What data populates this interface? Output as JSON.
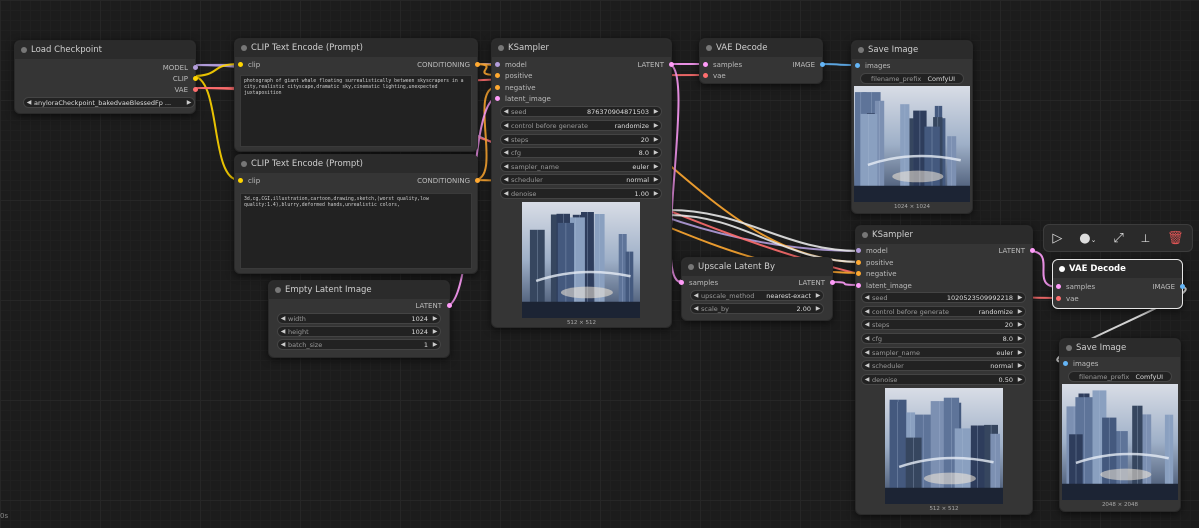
{
  "colors": {
    "model": "#b39ddb",
    "clip": "#ffd500",
    "vae": "#ff6e6e",
    "conditioning": "#ffa931",
    "latent": "#ff9cf9",
    "image": "#64b5f6"
  },
  "load_checkpoint": {
    "title": "Load Checkpoint",
    "out_model": "MODEL",
    "out_clip": "CLIP",
    "out_vae": "VAE",
    "ckpt": "anyloraCheckpoint_bakedvaeBlessedFp ..."
  },
  "clip_pos": {
    "title": "CLIP Text Encode (Prompt)",
    "in_clip": "clip",
    "out": "CONDITIONING",
    "text": "photograph of giant whale floating surrealistically between skyscrapers in a city,realistic cityscape,dramatic sky,cinematic lighting,unexpected juxtaposition"
  },
  "clip_neg": {
    "title": "CLIP Text Encode (Prompt)",
    "in_clip": "clip",
    "out": "CONDITIONING",
    "text": "3d,cg,CGI,illustration,cartoon,drawing,sketch,(worst quality,low quality:1.4),blurry,deformed hands,unrealistic colors,"
  },
  "empty_latent": {
    "title": "Empty Latent Image",
    "out": "LATENT",
    "width_label": "width",
    "width": "1024",
    "height_label": "height",
    "height": "1024",
    "batch_label": "batch_size",
    "batch": "1"
  },
  "ksampler1": {
    "title": "KSampler",
    "in_model": "model",
    "in_positive": "positive",
    "in_negative": "negative",
    "in_latent": "latent_image",
    "out": "LATENT",
    "seed_label": "seed",
    "seed": "876370904871503",
    "cbg_label": "control before generate",
    "cbg": "randomize",
    "steps_label": "steps",
    "steps": "20",
    "cfg_label": "cfg",
    "cfg": "8.0",
    "sampler_label": "sampler_name",
    "sampler": "euler",
    "scheduler_label": "scheduler",
    "scheduler": "normal",
    "denoise_label": "denoise",
    "denoise": "1.00",
    "preview_caption": "512 × 512"
  },
  "vae_decode1": {
    "title": "VAE Decode",
    "in_samples": "samples",
    "in_vae": "vae",
    "out": "IMAGE"
  },
  "save_image1": {
    "title": "Save Image",
    "in_images": "images",
    "prefix_label": "filename_prefix",
    "prefix": "ComfyUI",
    "caption": "1024 × 1024"
  },
  "upscale": {
    "title": "Upscale Latent By",
    "in_samples": "samples",
    "out": "LATENT",
    "method_label": "upscale_method",
    "method": "nearest-exact",
    "scale_label": "scale_by",
    "scale": "2.00"
  },
  "ksampler2": {
    "title": "KSampler",
    "in_model": "model",
    "in_positive": "positive",
    "in_negative": "negative",
    "in_latent": "latent_image",
    "out": "LATENT",
    "seed_label": "seed",
    "seed": "1020523509992218",
    "cbg_label": "control before generate",
    "cbg": "randomize",
    "steps_label": "steps",
    "steps": "20",
    "cfg_label": "cfg",
    "cfg": "8.0",
    "sampler_label": "sampler_name",
    "sampler": "euler",
    "scheduler_label": "scheduler",
    "scheduler": "normal",
    "denoise_label": "denoise",
    "denoise": "0.50",
    "preview_caption": "512 × 512"
  },
  "vae_decode2": {
    "title": "VAE Decode",
    "in_samples": "samples",
    "in_vae": "vae",
    "out": "IMAGE"
  },
  "save_image2": {
    "title": "Save Image",
    "in_images": "images",
    "prefix_label": "filename_prefix",
    "prefix": "ComfyUI",
    "caption": "2048 × 2048"
  },
  "toolbar": {
    "icons": [
      "play-icon",
      "color-circle-icon",
      "bypass-icon",
      "pin-icon",
      "delete-icon"
    ]
  },
  "corner_text": "0s"
}
